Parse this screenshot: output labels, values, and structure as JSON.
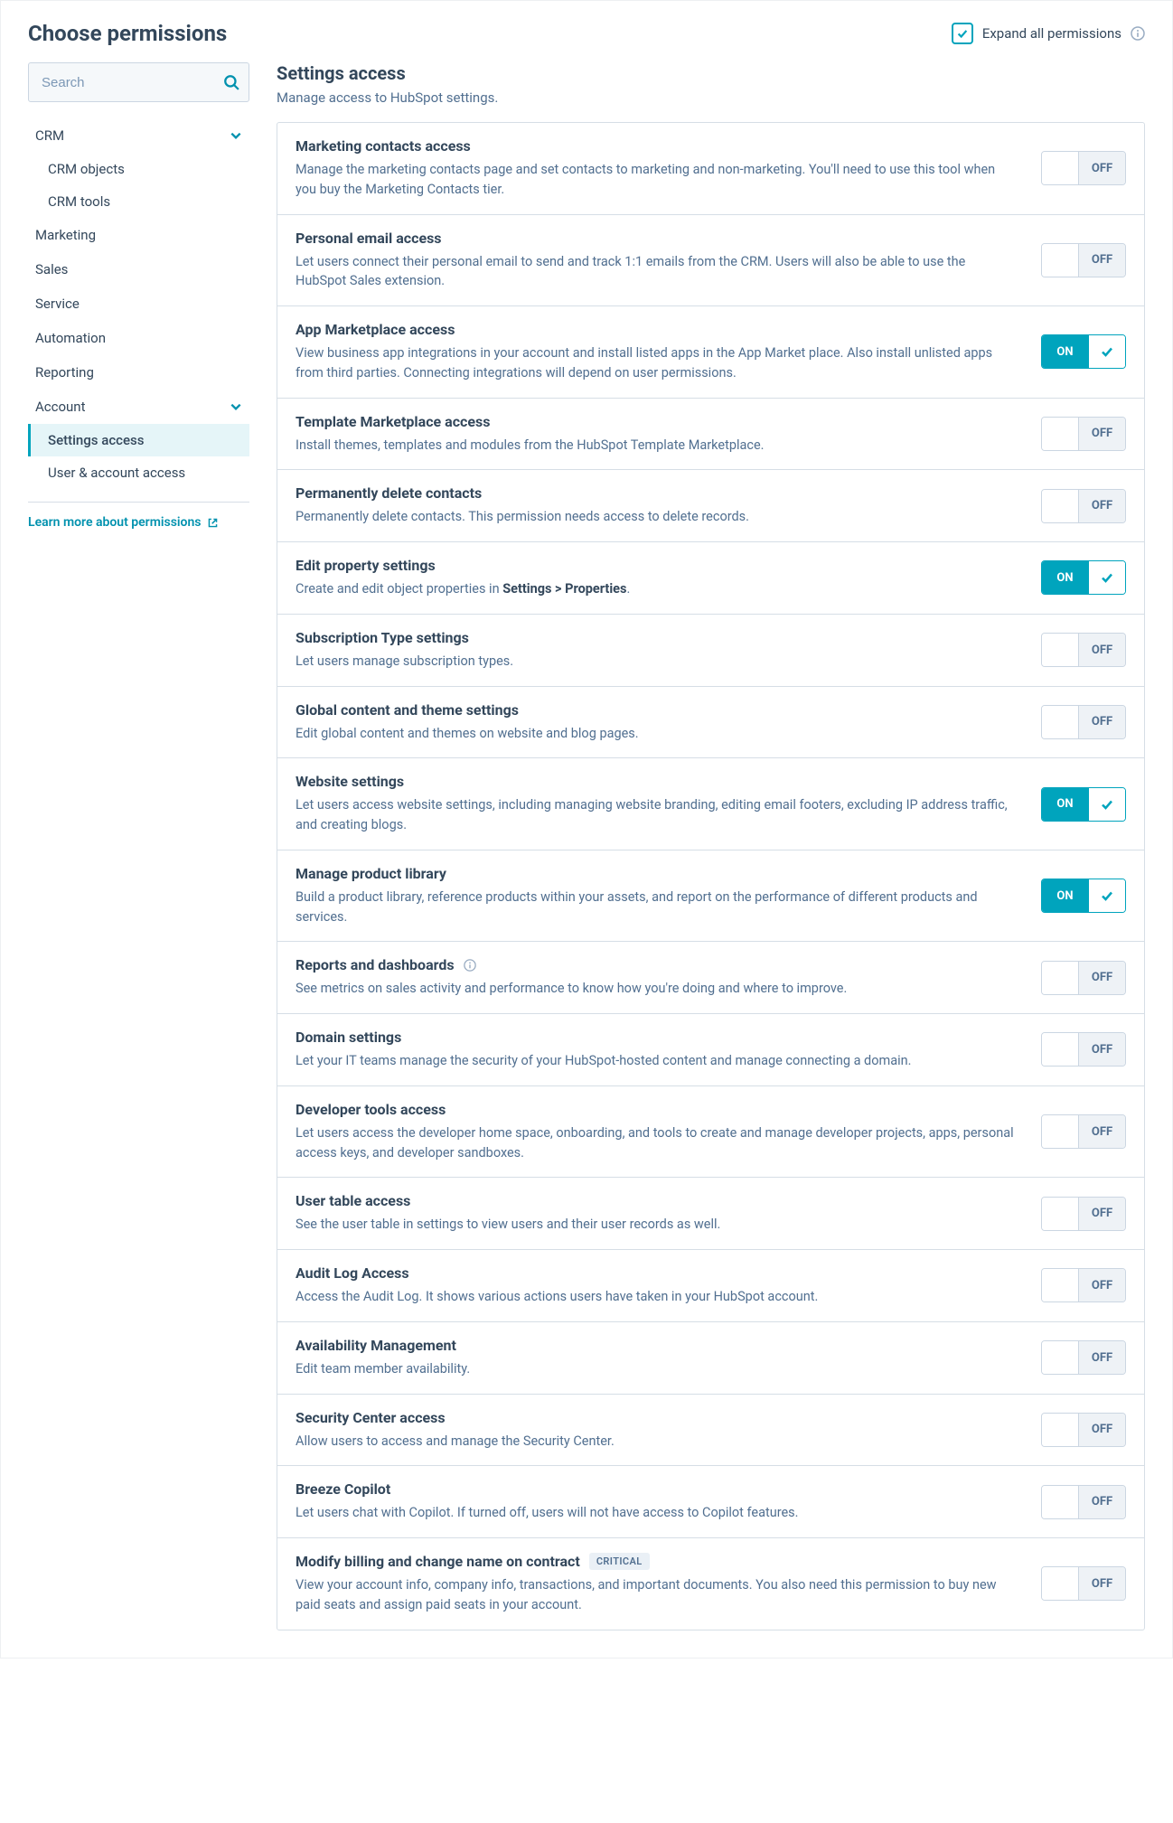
{
  "header": {
    "title": "Choose permissions",
    "expand_label": "Expand all permissions"
  },
  "search": {
    "placeholder": "Search"
  },
  "sidebar": {
    "groups": [
      {
        "label": "CRM",
        "expanded": true,
        "children": [
          {
            "label": "CRM objects"
          },
          {
            "label": "CRM tools"
          }
        ]
      },
      {
        "label": "Marketing"
      },
      {
        "label": "Sales"
      },
      {
        "label": "Service"
      },
      {
        "label": "Automation"
      },
      {
        "label": "Reporting"
      },
      {
        "label": "Account",
        "expanded": true,
        "children": [
          {
            "label": "Settings access",
            "active": true
          },
          {
            "label": "User & account access"
          }
        ]
      }
    ],
    "learn_more": "Learn more about permissions"
  },
  "main": {
    "title": "Settings access",
    "desc": "Manage access to HubSpot settings.",
    "on_label": "ON",
    "off_label": "OFF",
    "badge_critical": "CRITICAL",
    "rows": [
      {
        "title": "Marketing contacts access",
        "desc": "Manage the marketing contacts page and set contacts to marketing and non-marketing. You'll need to use this tool when you buy the Marketing Contacts tier.",
        "on": false
      },
      {
        "title": "Personal email access",
        "desc": "Let users connect their personal email to send and track 1:1 emails from the CRM. Users will also be able to use the HubSpot Sales extension.",
        "on": false
      },
      {
        "title": "App Marketplace access",
        "desc": "View business app integrations in your account and install listed apps in the App Market place. Also install unlisted apps from third parties. Connecting integrations will depend on user permissions.",
        "on": true
      },
      {
        "title": "Template Marketplace access",
        "desc": "Install themes, templates and modules from the HubSpot Template Marketplace.",
        "on": false
      },
      {
        "title": "Permanently delete contacts",
        "desc": "Permanently delete contacts. This permission needs access to delete records.",
        "on": false
      },
      {
        "title": "Edit property settings",
        "desc_html": "Create and edit object properties in <b>Settings > Properties</b>.",
        "on": true
      },
      {
        "title": "Subscription Type settings",
        "desc": "Let users manage subscription types.",
        "on": false
      },
      {
        "title": "Global content and theme settings",
        "desc": "Edit global content and themes on website and blog pages.",
        "on": false
      },
      {
        "title": "Website settings",
        "desc": "Let users access website settings, including managing website branding, editing email footers, excluding IP address traffic, and creating blogs.",
        "on": true
      },
      {
        "title": "Manage product library",
        "desc": "Build a product library, reference products within your assets, and report on the performance of different products and services.",
        "on": true
      },
      {
        "title": "Reports and dashboards",
        "info": true,
        "desc": "See metrics on sales activity and performance to know how you're doing and where to improve.",
        "on": false
      },
      {
        "title": "Domain settings",
        "desc": "Let your IT teams manage the security of your HubSpot-hosted content and manage connecting a domain.",
        "on": false
      },
      {
        "title": "Developer tools access",
        "desc": "Let users access the developer home space, onboarding, and tools to create and manage developer projects, apps, personal access keys, and developer sandboxes.",
        "on": false
      },
      {
        "title": "User table access",
        "desc": "See the user table in settings to view users and their user records as well.",
        "on": false
      },
      {
        "title": "Audit Log Access",
        "desc": "Access the Audit Log. It shows various actions users have taken in your HubSpot account.",
        "on": false
      },
      {
        "title": "Availability Management",
        "desc": "Edit team member availability.",
        "on": false
      },
      {
        "title": "Security Center access",
        "desc": "Allow users to access and manage the Security Center.",
        "on": false
      },
      {
        "title": "Breeze Copilot",
        "desc": "Let users chat with Copilot. If turned off, users will not have access to Copilot features.",
        "on": false
      },
      {
        "title": "Modify billing and change name on contract",
        "badge": "CRITICAL",
        "desc": "View your account info, company info, transactions, and important documents. You also need this permission to buy new paid seats and assign paid seats in your account.",
        "on": false
      }
    ]
  }
}
